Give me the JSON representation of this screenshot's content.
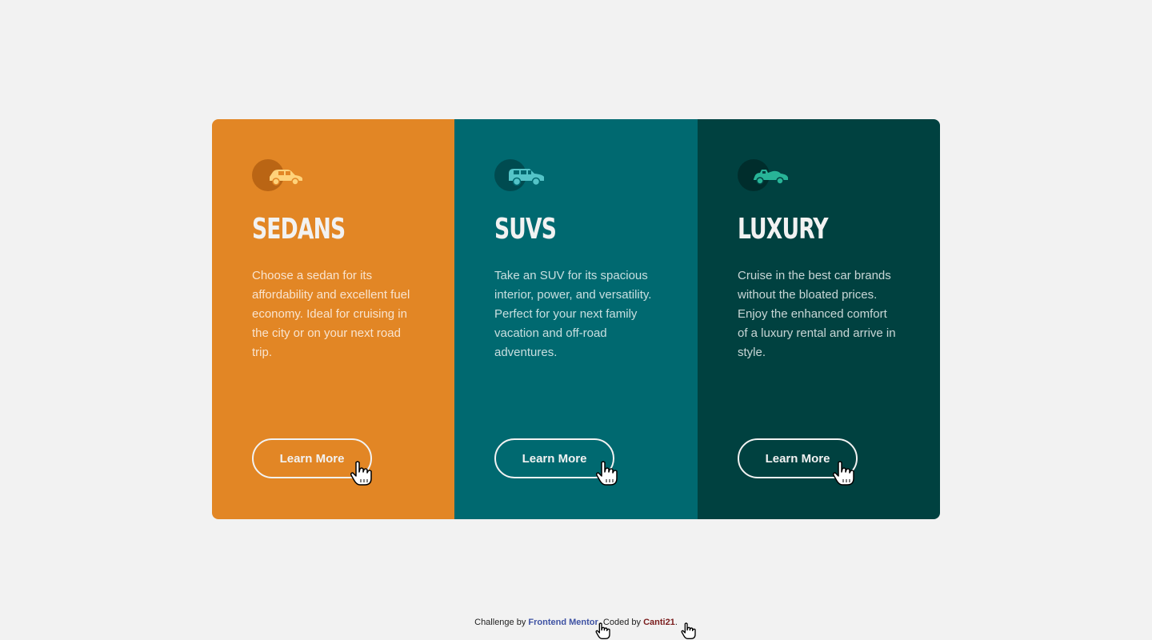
{
  "colors": {
    "background": "#f2f2f2",
    "sedans": "#e28625",
    "suvs": "#006970",
    "luxury": "#004140",
    "text_light": "#f2f2f2"
  },
  "cards": [
    {
      "title": "SEDANS",
      "description": "Choose a sedan for its affordability and excellent fuel economy. Ideal for cruising in the city or on your next road trip.",
      "button_label": "Learn More",
      "icon": "sedan-car-icon"
    },
    {
      "title": "SUVS",
      "description": "Take an SUV for its spacious interior, power, and versatility. Perfect for your next family vacation and off-road adventures.",
      "button_label": "Learn More",
      "icon": "suv-car-icon"
    },
    {
      "title": "LUXURY",
      "description": "Cruise in the best car brands without the bloated prices. Enjoy the enhanced comfort of a luxury rental and arrive in style.",
      "button_label": "Learn More",
      "icon": "luxury-car-icon"
    }
  ],
  "footer": {
    "prefix": "Challenge by ",
    "challenge_link": "Frontend Mentor",
    "middle": ". Coded by ",
    "author_link": "Canti21",
    "suffix": "."
  }
}
